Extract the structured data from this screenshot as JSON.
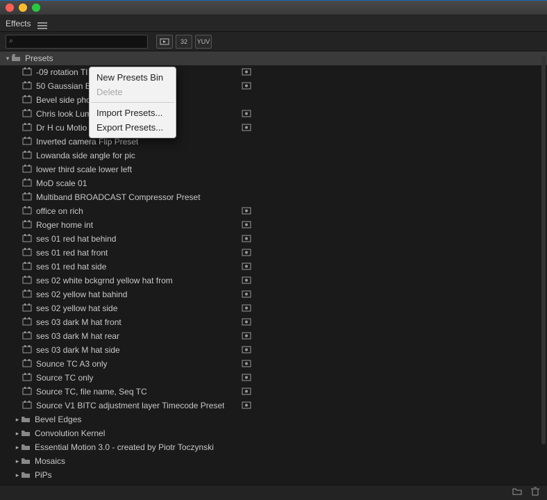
{
  "window": {
    "title": "Effects"
  },
  "toolbar": {
    "search_placeholder": "",
    "icons": {
      "fx": "FX",
      "thirtytwo": "32",
      "yuv": "YUV"
    }
  },
  "tree": {
    "root": {
      "name": "Presets"
    },
    "items": [
      {
        "label": "-09 rotation TI",
        "badge": true
      },
      {
        "label": "50 Gaussian B",
        "badge": true
      },
      {
        "label": "Bevel side pho",
        "badge": false
      },
      {
        "label": "Chris look Lum",
        "badge": true
      },
      {
        "label": "Dr H cu Motio",
        "badge": true
      },
      {
        "label": "Inverted camera Flip Preset",
        "badge": false
      },
      {
        "label": "Lowanda side angle for pic",
        "badge": false
      },
      {
        "label": "lower third scale lower left",
        "badge": false
      },
      {
        "label": "MoD scale 01",
        "badge": false
      },
      {
        "label": "Multiband  BROADCAST Compressor Preset",
        "badge": false
      },
      {
        "label": "office on rich",
        "badge": true
      },
      {
        "label": "Roger home int",
        "badge": true
      },
      {
        "label": "ses 01 red hat behind",
        "badge": true
      },
      {
        "label": "ses 01 red hat front",
        "badge": true
      },
      {
        "label": "ses 01 red hat side",
        "badge": true
      },
      {
        "label": "ses 02 white bckgrnd yellow hat from",
        "badge": true
      },
      {
        "label": "ses 02 yellow hat bahind",
        "badge": true
      },
      {
        "label": "ses 02 yellow hat side",
        "badge": true
      },
      {
        "label": "ses 03 dark M hat front",
        "badge": true
      },
      {
        "label": "ses 03 dark M hat rear",
        "badge": true
      },
      {
        "label": "ses 03 dark M hat side",
        "badge": true
      },
      {
        "label": "Sounce TC A3 only",
        "badge": true
      },
      {
        "label": "Source TC only",
        "badge": true
      },
      {
        "label": "Source TC, file name, Seq TC",
        "badge": true
      },
      {
        "label": "Source V1 BITC adjustment layer Timecode Preset",
        "badge": true
      }
    ],
    "folders": [
      {
        "label": "Bevel Edges"
      },
      {
        "label": "Convolution Kernel"
      },
      {
        "label": "Essential Motion 3.0 - created by Piotr Toczynski"
      },
      {
        "label": "Mosaics"
      },
      {
        "label": "PiPs"
      }
    ]
  },
  "context_menu": {
    "new_bin": "New Presets Bin",
    "delete": "Delete",
    "import": "Import Presets...",
    "export": "Export Presets..."
  },
  "colors": {
    "traffic_close": "#ff5f57",
    "traffic_min": "#febc2e",
    "traffic_max": "#28c840"
  }
}
